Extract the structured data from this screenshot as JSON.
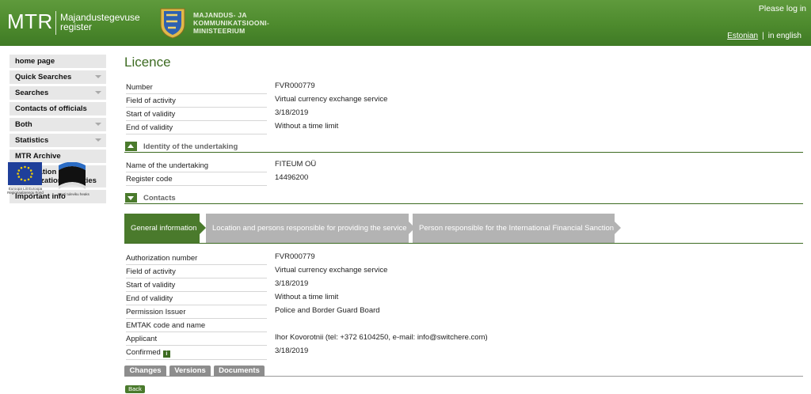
{
  "header": {
    "brand": "MTR",
    "brand_sub": "Majandustegevuse register",
    "ministry": "MAJANDUS- JA KOMMUNIKATSIOONI- MINISTEERIUM",
    "login": "Please log in",
    "lang_current": "Estonian",
    "lang_separator": "|",
    "lang_other": "in english"
  },
  "sidebar": {
    "items": [
      {
        "label": "home page",
        "dropdown": false
      },
      {
        "label": "Quick Searches",
        "dropdown": true
      },
      {
        "label": "Searches",
        "dropdown": true
      },
      {
        "label": "Contacts of officials",
        "dropdown": false
      },
      {
        "label": "Both",
        "dropdown": true
      },
      {
        "label": "Statistics",
        "dropdown": true
      },
      {
        "label": "MTR Archive",
        "dropdown": false
      },
      {
        "label": "Notification and authorization activities",
        "dropdown": false
      },
      {
        "label": "Important info",
        "dropdown": false
      }
    ],
    "eu_caption": "Euroopa Liit Euroopa Regionaalarengu Fond",
    "ee_caption": "Eesti tuleviku heaks"
  },
  "main": {
    "title": "Licence",
    "licence_fields": [
      {
        "label": "Number",
        "value": "FVR000779"
      },
      {
        "label": "Field of activity",
        "value": "Virtual currency exchange service"
      },
      {
        "label": "Start of validity",
        "value": "3/18/2019"
      },
      {
        "label": "End of validity",
        "value": "Without a time limit"
      }
    ],
    "identity_section": "Identity of the undertaking",
    "identity_fields": [
      {
        "label": "Name of the undertaking",
        "value": "FITEUM OÜ"
      },
      {
        "label": "Register code",
        "value": "14496200"
      }
    ],
    "contacts_section": "Contacts",
    "tabs": [
      "General information",
      "Location and persons responsible for providing the service",
      "Person responsible for the International Financial Sanction"
    ],
    "general_fields": [
      {
        "label": "Authorization number",
        "value": "FVR000779"
      },
      {
        "label": "Field of activity",
        "value": "Virtual currency exchange service"
      },
      {
        "label": "Start of validity",
        "value": "3/18/2019"
      },
      {
        "label": "End of validity",
        "value": "Without a time limit"
      },
      {
        "label": "Permission Issuer",
        "value": "Police and Border Guard Board"
      },
      {
        "label": "EMTAK code and name",
        "value": ""
      },
      {
        "label": "Applicant",
        "value": "Ihor Kovorotnii (tel: +372 6104250, e-mail: info@switchere.com)"
      },
      {
        "label": "Confirmed",
        "value": "3/18/2019"
      }
    ],
    "bottom_tabs": [
      "Changes",
      "Versions",
      "Documents"
    ],
    "back": "Back"
  },
  "colors": {
    "header_green": "#4d8a2d",
    "accent_green": "#4a7a2c",
    "title_green": "#3d6b22",
    "tab_inactive": "#b3b3b3"
  }
}
